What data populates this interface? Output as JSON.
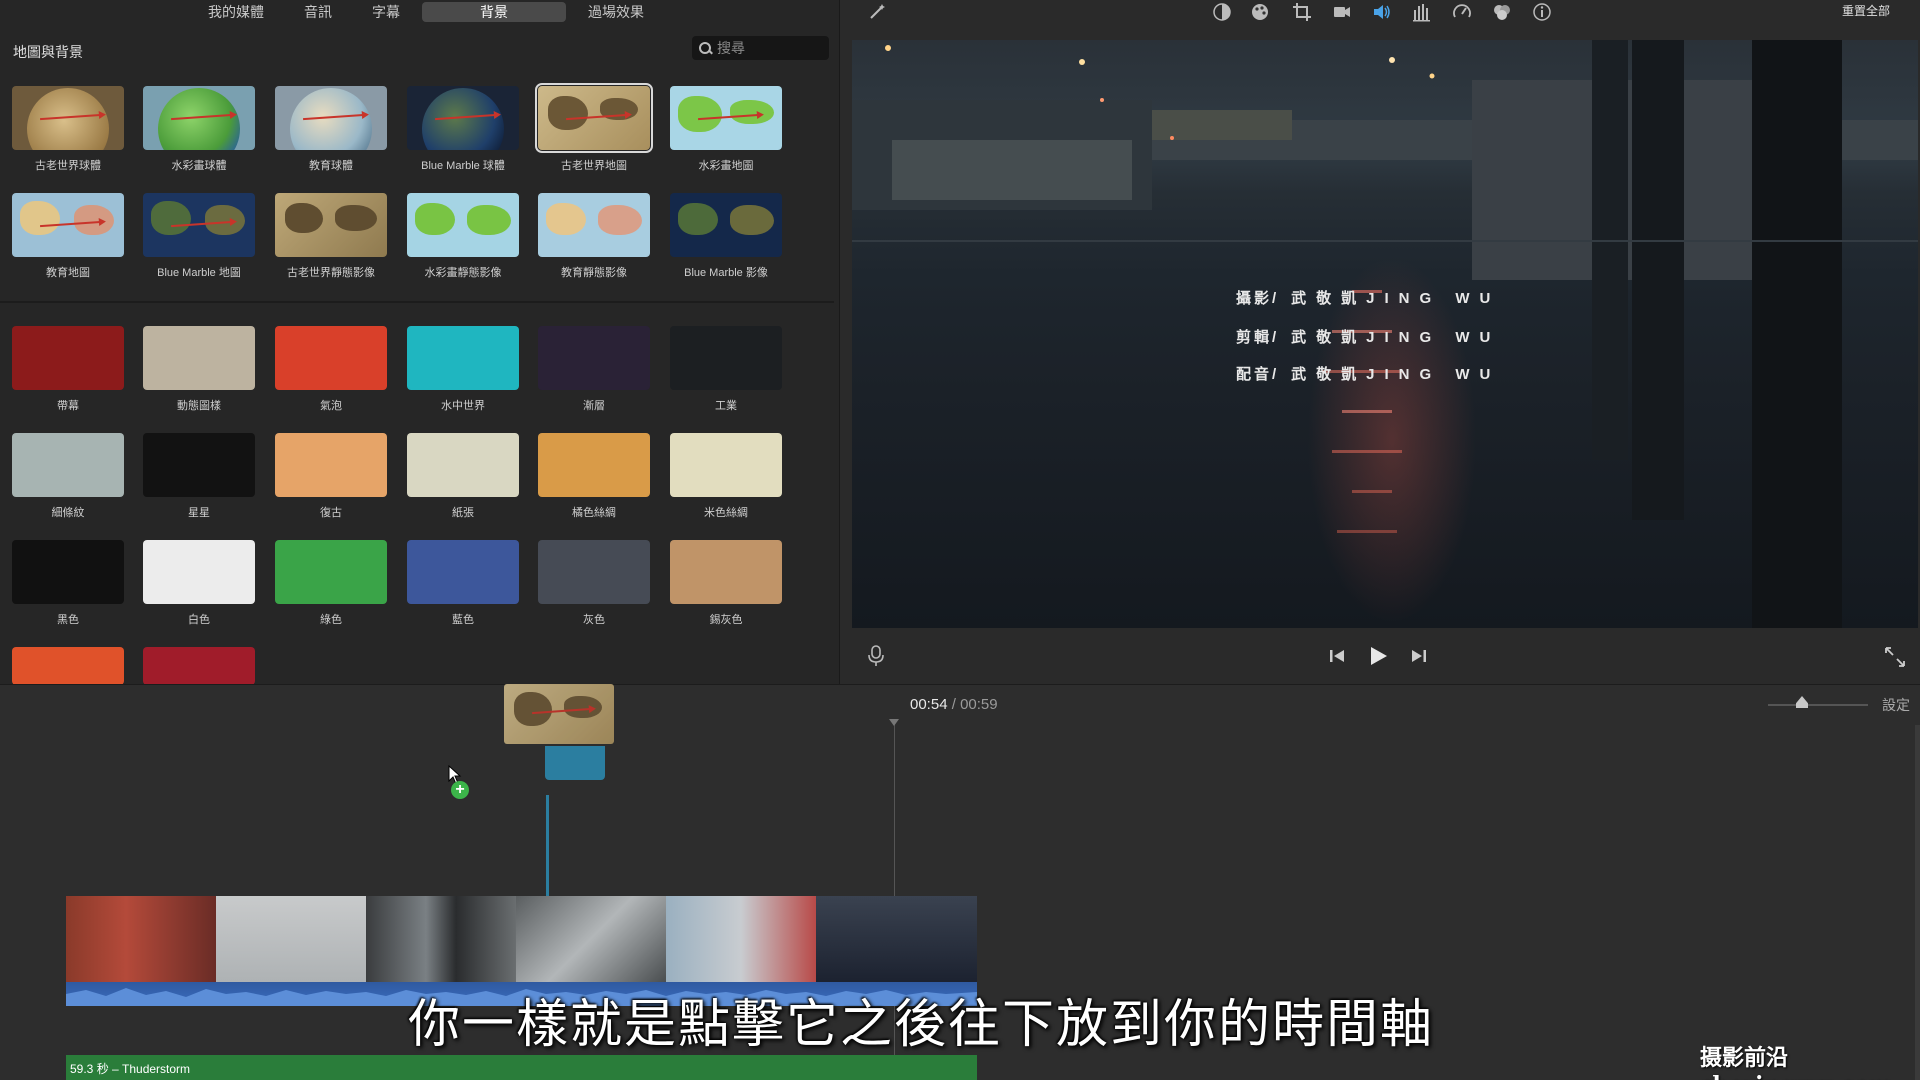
{
  "tabs": [
    "我的媒體",
    "音訊",
    "字幕",
    "背景",
    "過場效果"
  ],
  "active_tab": "背景",
  "category_title": "地圖與背景",
  "search_placeholder": "搜尋",
  "map_items": [
    {
      "label": "古老世界球體"
    },
    {
      "label": "水彩畫球體"
    },
    {
      "label": "教育球體"
    },
    {
      "label": "Blue Marble 球體"
    },
    {
      "label": "古老世界地圖"
    },
    {
      "label": "水彩畫地圖"
    },
    {
      "label": "教育地圖"
    },
    {
      "label": "Blue Marble 地圖"
    },
    {
      "label": "古老世界靜態影像"
    },
    {
      "label": "水彩畫靜態影像"
    },
    {
      "label": "教育靜態影像"
    },
    {
      "label": "Blue Marble 影像"
    }
  ],
  "background_items": [
    {
      "label": "帶幕",
      "color": "#8c1b1b"
    },
    {
      "label": "動態圖樣",
      "color": "#bdb3a0"
    },
    {
      "label": "氣泡",
      "color": "#d9402a"
    },
    {
      "label": "水中世界",
      "color": "#1fb6c0"
    },
    {
      "label": "漸層",
      "color": "#2a2236"
    },
    {
      "label": "工業",
      "color": "#1c1f22"
    },
    {
      "label": "細條紋",
      "color": "#a7b4b2"
    },
    {
      "label": "星星",
      "color": "#121212"
    },
    {
      "label": "復古",
      "color": "#e6a468"
    },
    {
      "label": "紙張",
      "color": "#d9d7c2"
    },
    {
      "label": "橘色絲綢",
      "color": "#d99b48"
    },
    {
      "label": "米色絲綢",
      "color": "#e2ddbf"
    },
    {
      "label": "黑色",
      "color": "#111111"
    },
    {
      "label": "白色",
      "color": "#ececec"
    },
    {
      "label": "綠色",
      "color": "#3aa448"
    },
    {
      "label": "藍色",
      "color": "#3d579b"
    },
    {
      "label": "灰色",
      "color": "#464b55"
    },
    {
      "label": "錫灰色",
      "color": "#c09468"
    },
    {
      "label": "",
      "color": "#e0522a"
    },
    {
      "label": "",
      "color": "#a01c2a"
    }
  ],
  "reset_all": "重置全部",
  "credits": [
    {
      "role": "攝影/",
      "name": "武敬凱JING WU"
    },
    {
      "role": "剪輯/",
      "name": "武敬凱JING WU"
    },
    {
      "role": "配音/",
      "name": "武敬凱JING WU"
    }
  ],
  "timecode": {
    "current": "00:54",
    "separator": "/",
    "total": "00:59"
  },
  "timeline_settings": "設定",
  "music_track": "59.3 秒 – Thuderstorm",
  "subtitle": "你一樣就是點擊它之後往下放到你的時間軸",
  "watermark": "摄影前沿 sheyingzyz.com",
  "toolbar_icons": [
    "magic-wand-icon",
    "color-balance-icon",
    "color-correction-icon",
    "crop-icon",
    "stabilization-icon",
    "volume-icon",
    "equalizer-icon",
    "speed-icon",
    "filter-icon",
    "info-icon"
  ]
}
